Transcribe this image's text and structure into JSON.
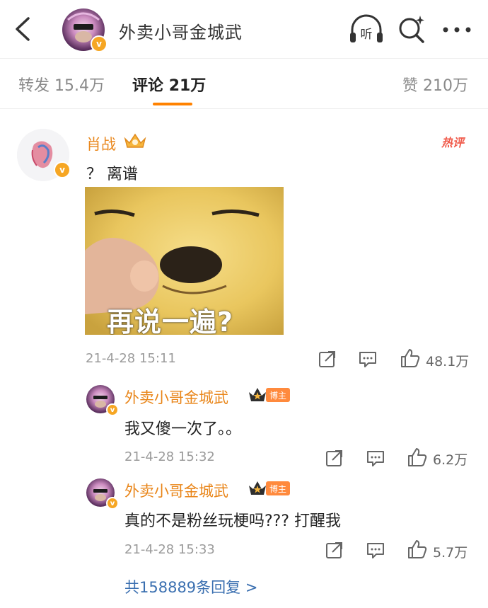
{
  "header": {
    "title": "外卖小哥金城武",
    "listen_label": "听",
    "verified_mark": "v"
  },
  "tabs": [
    {
      "label": "转发",
      "count": "15.4万"
    },
    {
      "label": "评论",
      "count": "21万"
    },
    {
      "label": "赞",
      "count": "210万"
    }
  ],
  "comment": {
    "author": "肖战",
    "hot_tag": "热评",
    "text": "？ 离谱",
    "image_caption": "再说一遍?",
    "time": "21-4-28 15:11",
    "likes": "48.1万"
  },
  "replies": [
    {
      "author": "外卖小哥金城武",
      "badge": "博主",
      "text": "我又傻一次了。。",
      "time": "21-4-28 15:32",
      "likes": "6.2万"
    },
    {
      "author": "外卖小哥金城武",
      "badge": "博主",
      "text": "真的不是粉丝玩梗吗???  打醒我",
      "time": "21-4-28 15:33",
      "likes": "5.7万"
    }
  ],
  "more_replies": "共158889条回复 >",
  "colors": {
    "accent": "#ff8200",
    "name": "#e9861a",
    "link": "#3a6fb0",
    "hot": "#f05a4a"
  }
}
